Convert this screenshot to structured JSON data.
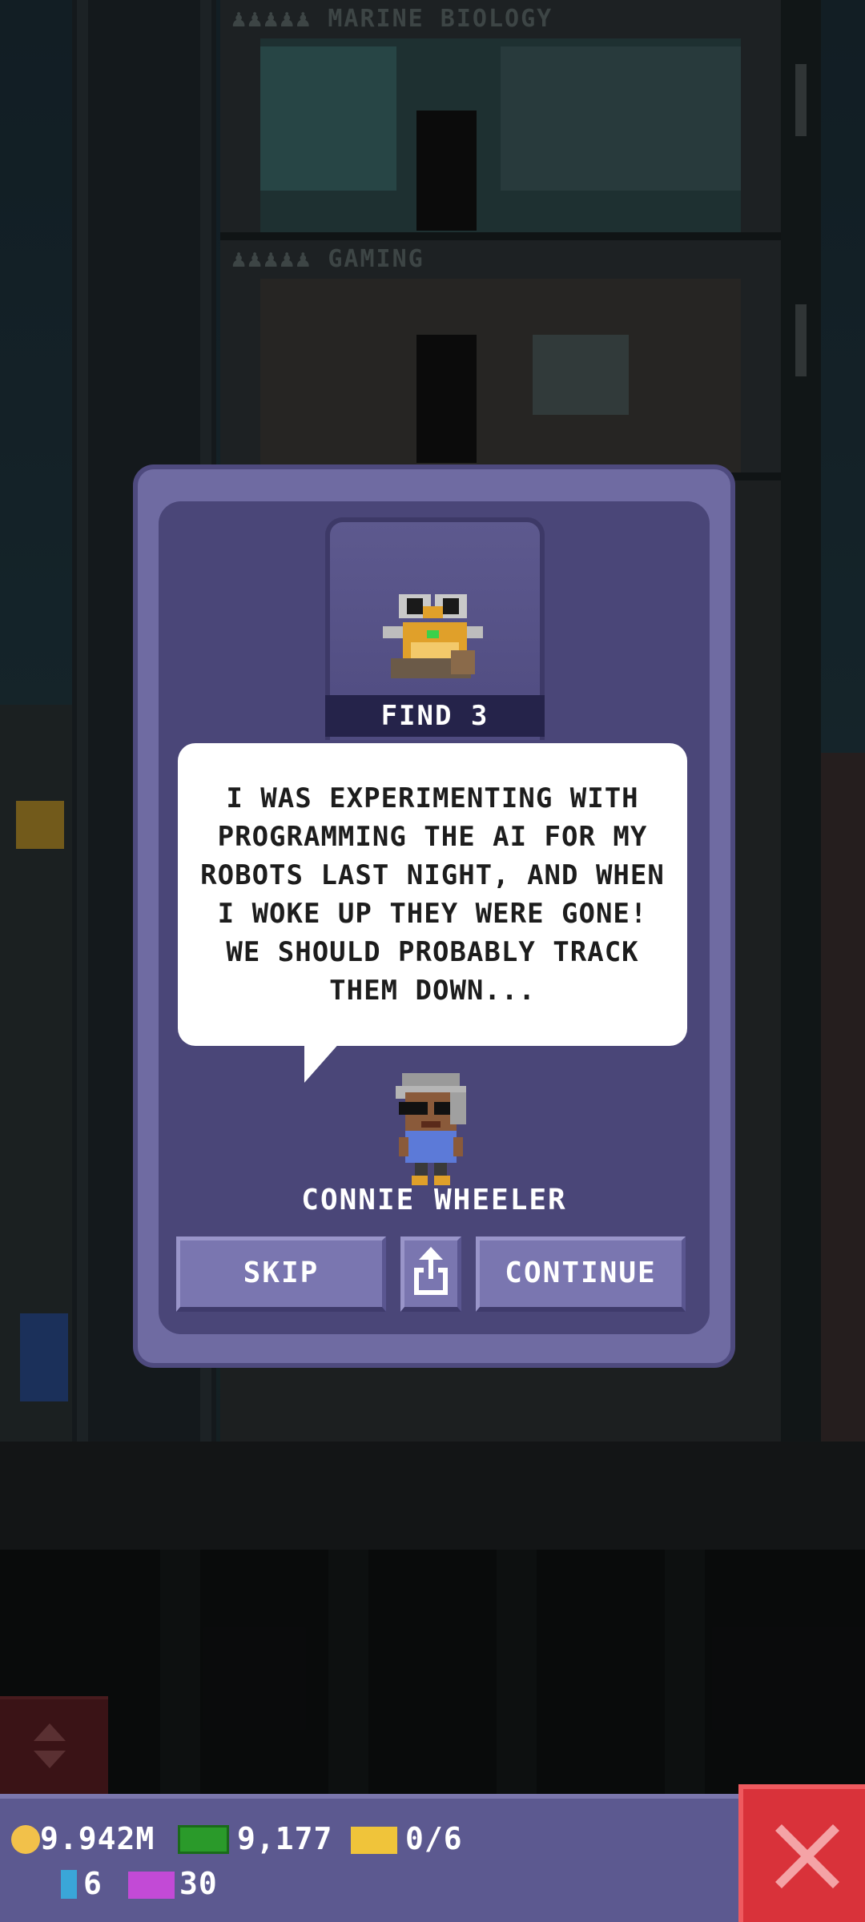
{
  "tower": {
    "floors": [
      {
        "name": "MARINE BIOLOGY"
      },
      {
        "name": "GAMING"
      }
    ]
  },
  "dialog": {
    "quest_label": "FIND 3",
    "message": "I WAS EXPERIMENTING WITH PROGRAMMING THE AI FOR MY ROBOTS LAST NIGHT, AND WHEN I WOKE UP THEY WERE GONE! WE SHOULD PROBABLY TRACK THEM DOWN...",
    "speaker_name": "CONNIE WHEELER",
    "buttons": {
      "skip": "SKIP",
      "share_icon": "share-icon",
      "continue": "CONTINUE"
    }
  },
  "hud": {
    "coins": "9.942M",
    "bux": "9,177",
    "tickets": "0/6",
    "keys": "6",
    "vip_count": "30",
    "icons": [
      "coin-icon",
      "bux-icon",
      "ticket-icon",
      "key-icon",
      "vip-ticket-icon",
      "close-icon"
    ]
  },
  "colors": {
    "dialog_outer": "#6f6ba2",
    "dialog_inner": "#4a4678",
    "button": "#7a76b0",
    "close_button": "#d9323a",
    "hud": "#5c5990"
  }
}
